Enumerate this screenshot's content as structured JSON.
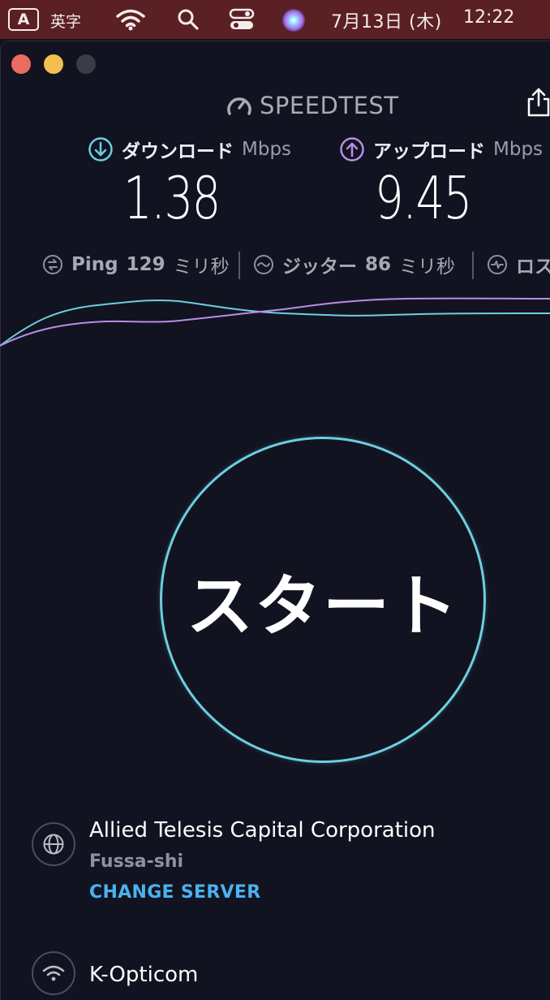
{
  "menubar": {
    "input_mode_letter": "A",
    "input_mode_label": "英字",
    "date": "7月13日 (木)",
    "time": "12:22",
    "icons": [
      "wifi-icon",
      "search-icon",
      "control-center-icon",
      "siri-icon"
    ],
    "bg_color": "#5a2024"
  },
  "app": {
    "logo_text": "SPEEDTEST",
    "download": {
      "label": "ダウンロード",
      "unit": "Mbps",
      "value": "1.38",
      "color": "#6ccfe0"
    },
    "upload": {
      "label": "アップロード",
      "unit": "Mbps",
      "value": "9.45",
      "color": "#b88de8"
    },
    "ping": {
      "label": "Ping",
      "value": "129",
      "unit": "ミリ秒"
    },
    "jitter": {
      "label": "ジッター",
      "value": "86",
      "unit": "ミリ秒"
    },
    "loss": {
      "label": "ロス"
    },
    "start_label": "スタート",
    "server": {
      "name": "Allied Telesis Capital Corporation",
      "location": "Fussa-shi",
      "change_label": "CHANGE SERVER"
    },
    "connection": {
      "name": "K-Opticom"
    }
  }
}
